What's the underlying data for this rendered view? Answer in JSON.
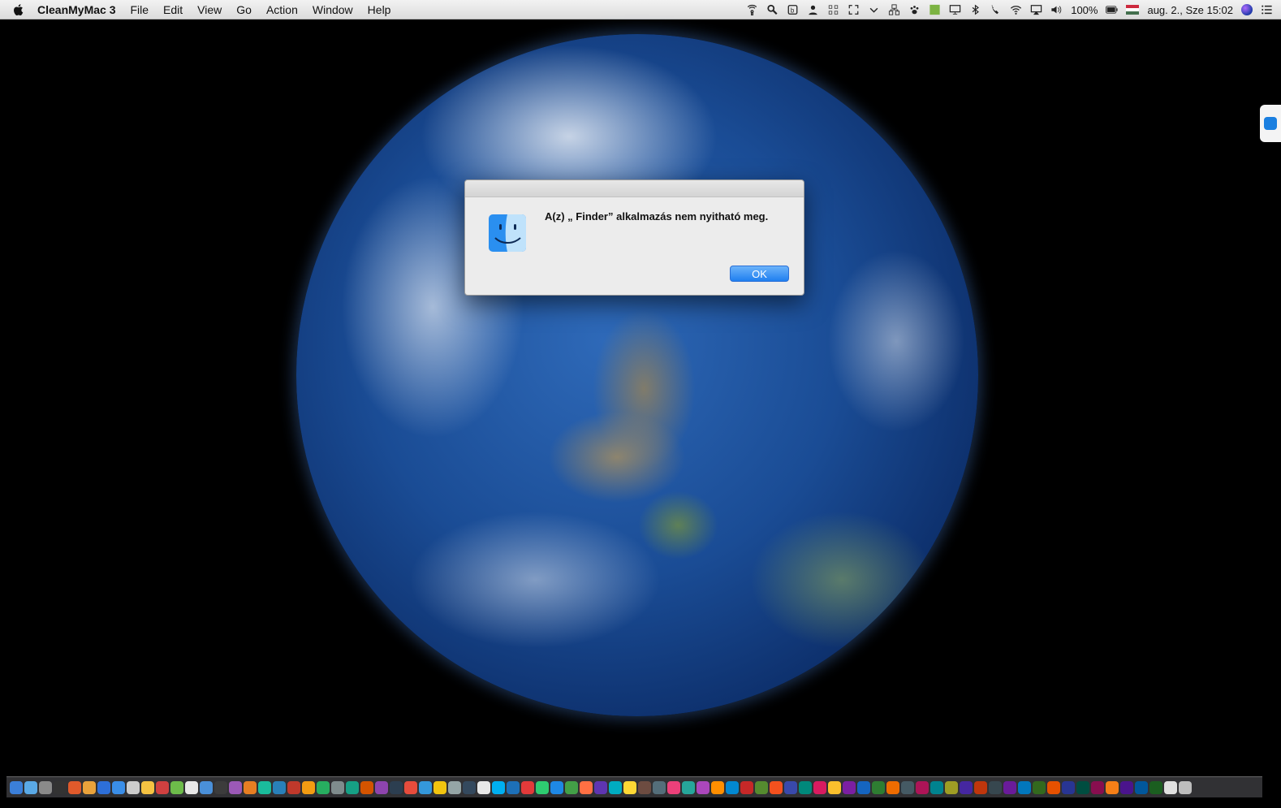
{
  "menubar": {
    "app_name": "CleanMyMac 3",
    "items": [
      "File",
      "Edit",
      "View",
      "Go",
      "Action",
      "Window",
      "Help"
    ],
    "battery": "100%",
    "datetime": "aug. 2., Sze  15:02"
  },
  "dialog": {
    "message": "A(z) „ Finder” alkalmazás nem nyitható meg.",
    "ok_label": "OK"
  },
  "colors": {
    "accent": "#1f7ff0",
    "dock_icons": [
      "#3b7fd9",
      "#5aa9e6",
      "#8a8a8a",
      "#333333",
      "#e05a2b",
      "#e9a23b",
      "#2d6fd8",
      "#3a8ee8",
      "#cccccc",
      "#f5c242",
      "#d04040",
      "#6dbb4a",
      "#e8e8e8",
      "#4a90d9",
      "#3c3c3c",
      "#9b59b6",
      "#e67e22",
      "#1abc9c",
      "#2980b9",
      "#c0392b",
      "#f39c12",
      "#27ae60",
      "#7f8c8d",
      "#16a085",
      "#d35400",
      "#8e44ad",
      "#2c3e50",
      "#e74c3c",
      "#3498db",
      "#f1c40f",
      "#95a5a6",
      "#34495e",
      "#e8e8e8",
      "#00aff0",
      "#1d70b8",
      "#e23a3a",
      "#2ecc71",
      "#1e88e5",
      "#43a047",
      "#ff7043",
      "#5e35b1",
      "#00acc1",
      "#fdd835",
      "#6d4c41",
      "#546e7a",
      "#ec407a",
      "#26a69a",
      "#ab47bc",
      "#ff8f00",
      "#0288d1",
      "#c62828",
      "#558b2f",
      "#f4511e",
      "#3949ab",
      "#00897b",
      "#d81b60",
      "#fbc02d",
      "#7b1fa2",
      "#1565c0",
      "#2e7d32",
      "#ef6c00",
      "#455a64",
      "#ad1457",
      "#00838f",
      "#9e9d24",
      "#4527a0",
      "#bf360c",
      "#37474f",
      "#6a1b9a",
      "#0277bd",
      "#33691e",
      "#e65100",
      "#283593",
      "#004d40",
      "#880e4f",
      "#f57f17",
      "#4a148c",
      "#01579b",
      "#1b5e20",
      "#e0e0e0",
      "#bdbdbd"
    ]
  }
}
